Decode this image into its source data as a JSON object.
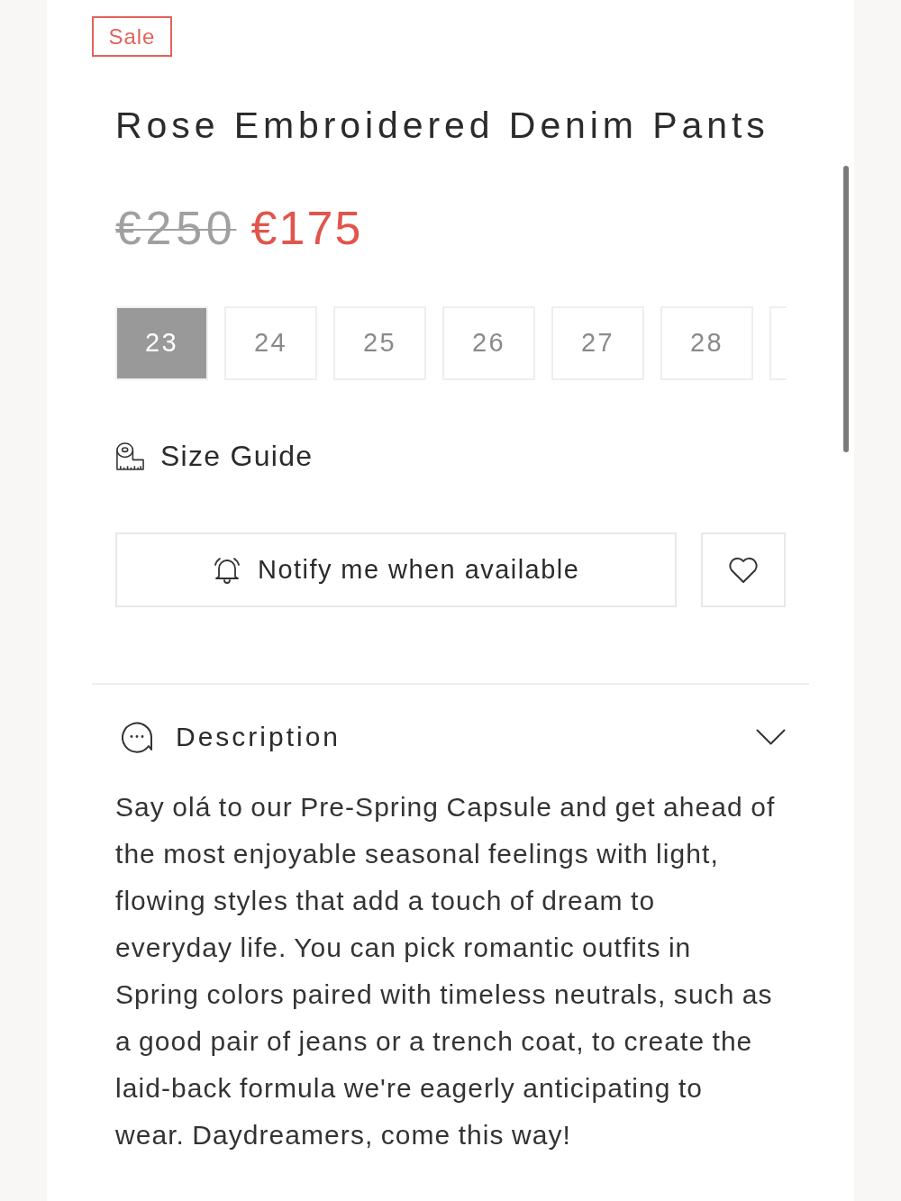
{
  "badge": {
    "text": "Sale"
  },
  "product": {
    "title": "Rose Embroidered Denim Pants"
  },
  "price": {
    "original": "€250",
    "sale": "€175"
  },
  "sizes": [
    {
      "label": "23",
      "selected": true
    },
    {
      "label": "24",
      "selected": false
    },
    {
      "label": "25",
      "selected": false
    },
    {
      "label": "26",
      "selected": false
    },
    {
      "label": "27",
      "selected": false
    },
    {
      "label": "28",
      "selected": false
    }
  ],
  "size_guide": {
    "label": "Size Guide"
  },
  "notify_button": {
    "label": "Notify me when available"
  },
  "description": {
    "heading": "Description",
    "expanded": true,
    "text": "Say olá to our Pre-Spring Capsule and get ahead of the most enjoyable seasonal feelings with light, flowing styles that add a touch of dream to everyday life. You can pick romantic outfits in Spring colors paired with timeless neutrals, such as a good pair of jeans or a trench coat, to create the laid-back formula we're eagerly anticipating to wear. Daydreamers, come this way!"
  }
}
